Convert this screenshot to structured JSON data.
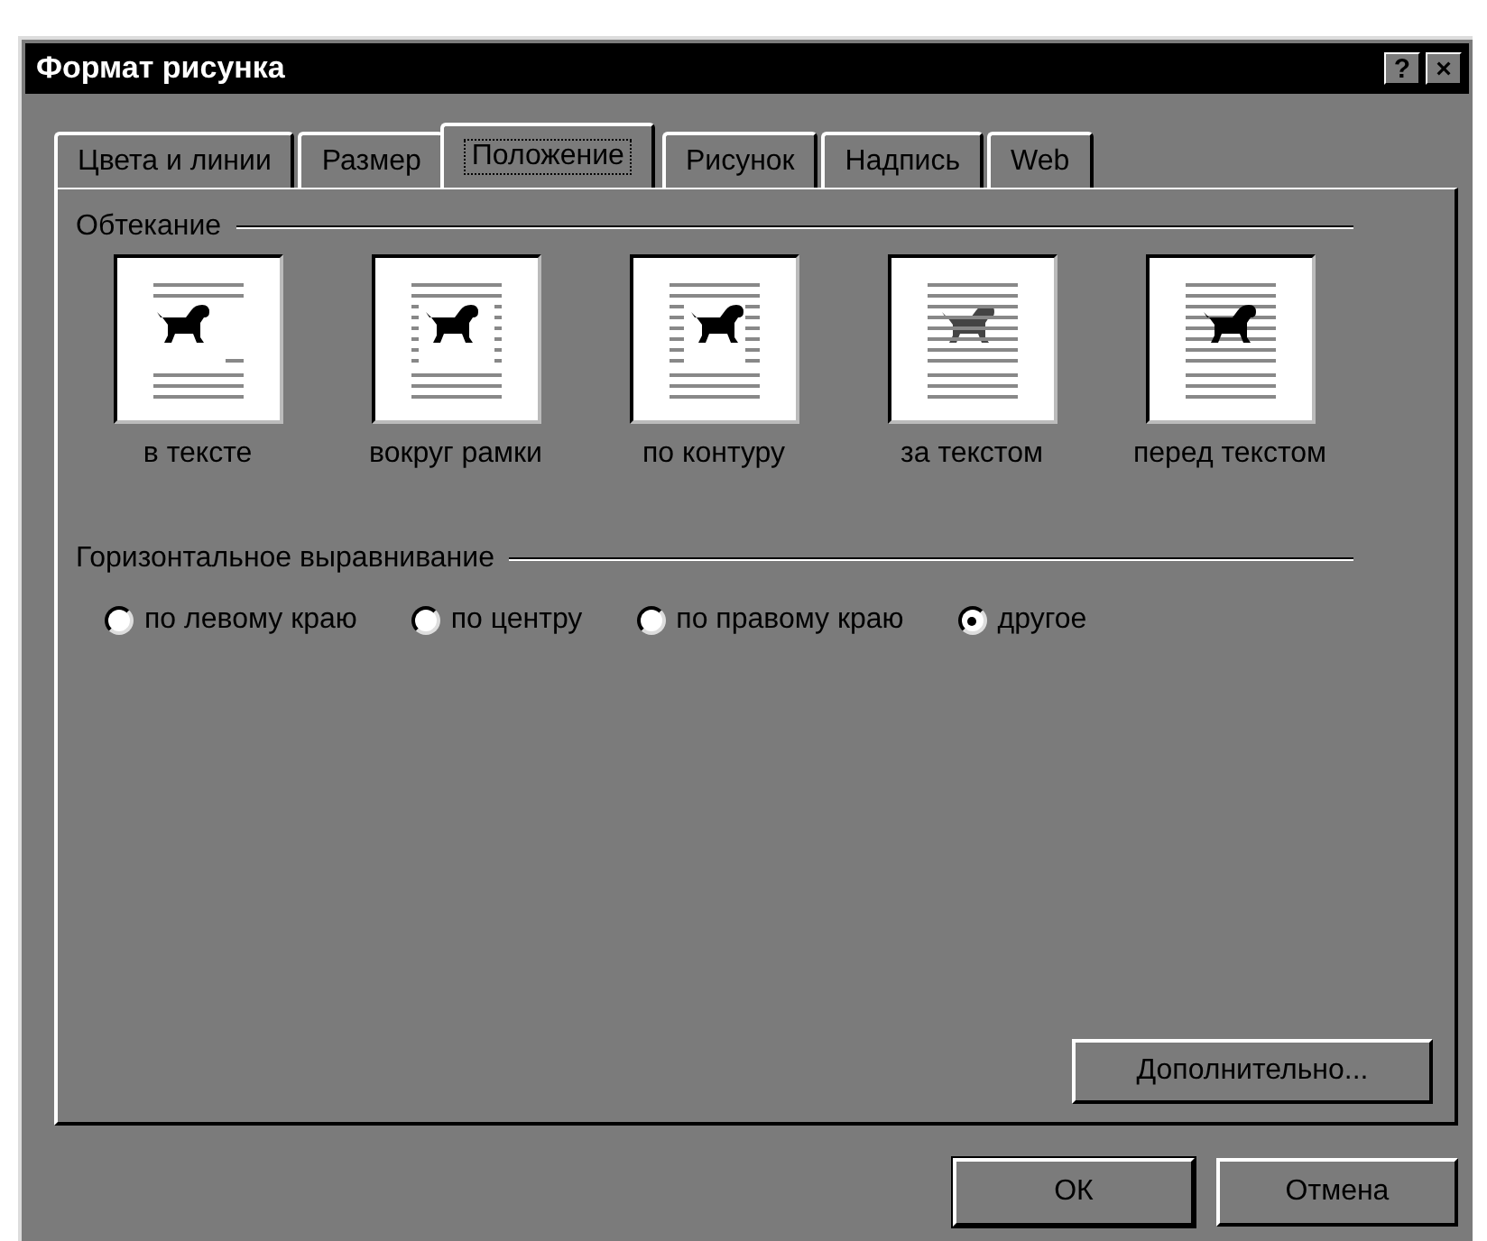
{
  "window": {
    "title": "Формат рисунка",
    "help": "?",
    "close": "×"
  },
  "tabs": [
    {
      "label": "Цвета и линии",
      "selected": false
    },
    {
      "label": "Размер",
      "selected": false
    },
    {
      "label": "Положение",
      "selected": true
    },
    {
      "label": "Рисунок",
      "selected": false
    },
    {
      "label": "Надпись",
      "selected": false
    },
    {
      "label": "Web",
      "selected": false
    }
  ],
  "wrapping": {
    "title": "Обтекание",
    "styles": [
      {
        "kind": "inline",
        "label": "в тексте"
      },
      {
        "kind": "square",
        "label": "вокруг рамки"
      },
      {
        "kind": "tight",
        "label": "по контуру"
      },
      {
        "kind": "behind",
        "label": "за текстом"
      },
      {
        "kind": "front",
        "label": "перед текстом"
      }
    ]
  },
  "horizontal_alignment": {
    "title": "Горизонтальное выравнивание",
    "options": [
      {
        "label": "по левому краю",
        "selected": false
      },
      {
        "label": "по центру",
        "selected": false
      },
      {
        "label": "по правому краю",
        "selected": false
      },
      {
        "label": "другое",
        "selected": true
      }
    ]
  },
  "advanced_button": "Дополнительно...",
  "buttons": [
    "ОК",
    "Отмена"
  ]
}
